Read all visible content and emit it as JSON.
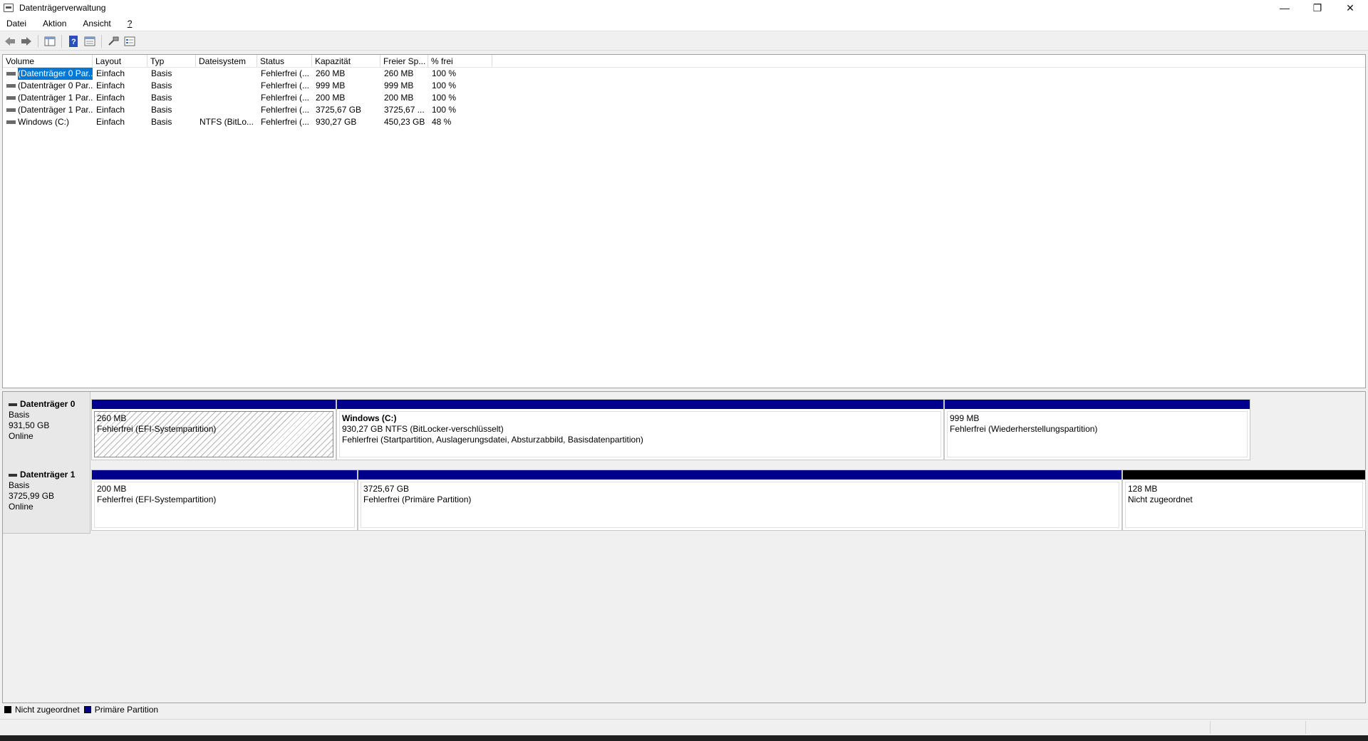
{
  "window": {
    "title": "Datenträgerverwaltung",
    "minimize_glyph": "—",
    "restore_glyph": "❐",
    "close_glyph": "✕"
  },
  "menu": [
    "Datei",
    "Aktion",
    "Ansicht",
    "?"
  ],
  "toolbar": {
    "icons": [
      "back-icon",
      "forward-icon",
      "console-tree-icon",
      "help-icon",
      "properties-icon",
      "rescan-icon",
      "list-view-icon"
    ]
  },
  "volume_list": {
    "columns": [
      "Volume",
      "Layout",
      "Typ",
      "Dateisystem",
      "Status",
      "Kapazität",
      "Freier Sp...",
      "% frei"
    ],
    "rows": [
      [
        "(Datenträger 0 Par...",
        "Einfach",
        "Basis",
        "",
        "Fehlerfrei (...",
        "260 MB",
        "260 MB",
        "100 %"
      ],
      [
        "(Datenträger 0 Par...",
        "Einfach",
        "Basis",
        "",
        "Fehlerfrei (...",
        "999 MB",
        "999 MB",
        "100 %"
      ],
      [
        "(Datenträger 1 Par...",
        "Einfach",
        "Basis",
        "",
        "Fehlerfrei (...",
        "200 MB",
        "200 MB",
        "100 %"
      ],
      [
        "(Datenträger 1 Par...",
        "Einfach",
        "Basis",
        "",
        "Fehlerfrei (...",
        "3725,67 GB",
        "3725,67 ...",
        "100 %"
      ],
      [
        "Windows (C:)",
        "Einfach",
        "Basis",
        "NTFS (BitLo...",
        "Fehlerfrei (...",
        "930,27 GB",
        "450,23 GB",
        "48 %"
      ]
    ]
  },
  "disks": [
    {
      "name": "Datenträger 0",
      "type": "Basis",
      "size": "931,50 GB",
      "state": "Online",
      "partitions": [
        {
          "label": "",
          "size": "260 MB",
          "status": "Fehlerfrei (EFI-Systempartition)",
          "kind": "primary",
          "hatch": true
        },
        {
          "label": "Windows  (C:)",
          "size": "930,27 GB NTFS (BitLocker-verschlüsselt)",
          "status": "Fehlerfrei (Startpartition, Auslagerungsdatei, Absturzabbild, Basisdatenpartition)",
          "kind": "primary",
          "hatch": false
        },
        {
          "label": "",
          "size": "999 MB",
          "status": "Fehlerfrei (Wiederherstellungspartition)",
          "kind": "primary",
          "hatch": false
        }
      ]
    },
    {
      "name": "Datenträger 1",
      "type": "Basis",
      "size": "3725,99 GB",
      "state": "Online",
      "partitions": [
        {
          "label": "",
          "size": "200 MB",
          "status": "Fehlerfrei (EFI-Systempartition)",
          "kind": "primary",
          "hatch": false
        },
        {
          "label": "",
          "size": "3725,67 GB",
          "status": "Fehlerfrei (Primäre Partition)",
          "kind": "primary",
          "hatch": false
        },
        {
          "label": "",
          "size": "128 MB",
          "status": "Nicht zugeordnet",
          "kind": "unalloc",
          "hatch": false
        }
      ]
    }
  ],
  "legend": [
    {
      "label": "Nicht zugeordnet",
      "color": "#000000"
    },
    {
      "label": "Primäre Partition",
      "color": "#00008b"
    }
  ]
}
